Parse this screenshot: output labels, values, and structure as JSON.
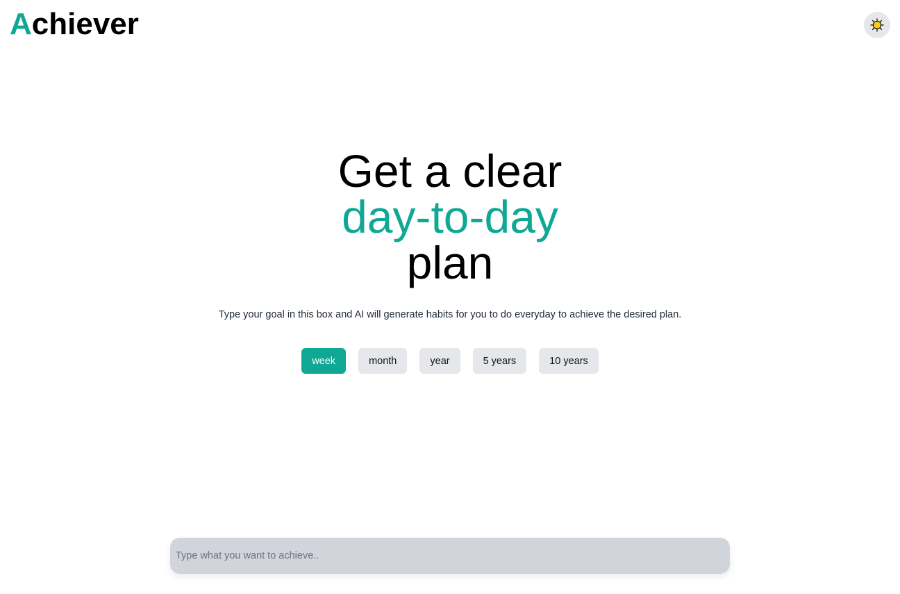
{
  "header": {
    "logo_first_letter": "A",
    "logo_rest": "chiever",
    "theme_toggle_icon": "sun-icon"
  },
  "hero": {
    "line1": "Get a clear",
    "line2": "day-to-day",
    "line3": "plan"
  },
  "subtitle": "Type your goal in this box and AI will generate habits for you to do everyday to achieve the desired plan.",
  "periods": {
    "selected": "week",
    "options": [
      "week",
      "month",
      "year",
      "5 years",
      "10 years"
    ]
  },
  "goal_input": {
    "value": "",
    "placeholder": "Type what you want to achieve.."
  },
  "colors": {
    "accent": "#0ea894",
    "button_bg": "#e5e7eb",
    "input_bg": "#d1d5db",
    "sun_fill": "#facc15"
  }
}
